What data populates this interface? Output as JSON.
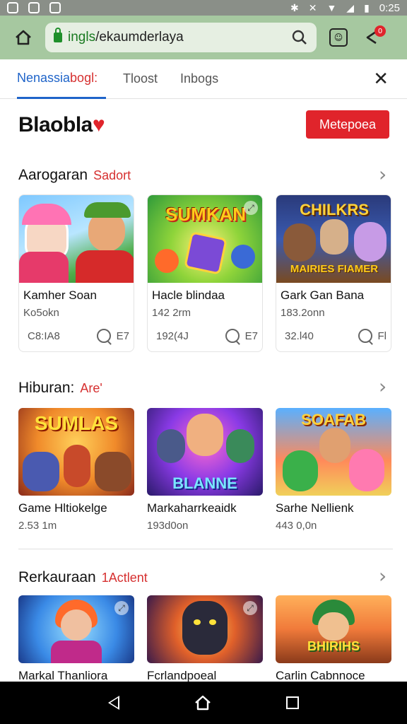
{
  "statusbar": {
    "time": "0:25"
  },
  "browser": {
    "url_domain": "ingls",
    "url_path": "/ekaumderlaya",
    "notification_count": "0"
  },
  "tabs": [
    {
      "label": "Nenassia",
      "hot": "bogl:"
    },
    {
      "label": "Tloost"
    },
    {
      "label": "Inbogs"
    }
  ],
  "brand": {
    "name": "Blaobla",
    "heart": "♥",
    "cta": "Metepoea"
  },
  "sections": [
    {
      "title": "Aarogaran",
      "tag": "Sadort",
      "cards": [
        {
          "thumb_text": "",
          "title": "Kamher Soan",
          "sub": "Ko5okn",
          "stat": "C8:IA8",
          "comments": "E7"
        },
        {
          "thumb_text": "SUMKAN",
          "title": "Hacle blindaa",
          "sub": "142 2rm",
          "stat": "192(4J",
          "comments": "E7"
        },
        {
          "thumb_text": "CHILKRS",
          "thumb_text2": "MAIRIES FIAMER",
          "title": "Gark Gan Bana",
          "sub": "183.2onn",
          "stat": "32.l40",
          "comments": "Fl"
        }
      ]
    },
    {
      "title": "Hiburan:",
      "tag": "Are'",
      "cards": [
        {
          "thumb_text": "SUMLAS",
          "title": "Game Hltiokelge",
          "sub": "2.53 1m"
        },
        {
          "thumb_text": "BLANNE",
          "title": "Markaharrkeaidk",
          "sub": "193d0on"
        },
        {
          "thumb_text": "SOAFAB",
          "title": "Sarhe Nellienk",
          "sub": "443 0,0n"
        }
      ]
    },
    {
      "title": "Rerkauraan",
      "tag": "1Actlent",
      "cards": [
        {
          "thumb_text": "",
          "title": "Markal Thanliora"
        },
        {
          "thumb_text": "",
          "title": "Fcrlandpoeal"
        },
        {
          "thumb_text": "BHIRIHS",
          "title": "Carlin Cabnnoce"
        }
      ]
    }
  ],
  "colors": {
    "accent": "#1f64c9",
    "brand_red": "#e0242b",
    "browser_bar": "#a6c8a0"
  }
}
